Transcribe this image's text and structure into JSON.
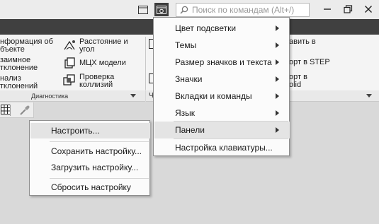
{
  "search": {
    "placeholder": "Поиск по командам (Alt+/)"
  },
  "ribbon": {
    "group1": {
      "col1": [
        "нформация об",
        "бъекте",
        "заимное",
        "тклонение",
        "нализ",
        "тклонений"
      ],
      "col2": [
        {
          "lines": [
            "Расстояние и",
            "угол"
          ],
          "icon": "distance-angle-icon"
        },
        {
          "lines": [
            "МЦХ модели"
          ],
          "icon": "mass-properties-icon"
        },
        {
          "lines": [
            "Проверка",
            "коллизий"
          ],
          "icon": "collision-check-icon"
        }
      ],
      "footer": "Диагностика"
    },
    "group3": {
      "col": [
        "авить в",
        "орт в STEP",
        "орт в",
        "olid"
      ]
    },
    "partial_letter": "Ч"
  },
  "dropdown": {
    "items": [
      {
        "label": "Цвет подсветки",
        "submenu": true
      },
      {
        "label": "Темы",
        "submenu": true
      },
      {
        "label": "Размер значков и текста",
        "submenu": true
      },
      {
        "label": "Значки",
        "submenu": true
      },
      {
        "label": "Вкладки и команды",
        "submenu": true
      },
      {
        "label": "Язык",
        "submenu": true
      },
      {
        "label": "Панели",
        "submenu": true,
        "highlighted": true
      },
      {
        "label": "Настройка клавиатуры...",
        "submenu": false
      }
    ]
  },
  "context_menu": {
    "items": [
      {
        "label": "Настроить...",
        "highlighted": true
      },
      {
        "label": "Сохранить настройку..."
      },
      {
        "label": "Загрузить настройку..."
      },
      {
        "label": "Сбросить настройку"
      }
    ]
  },
  "colors": {
    "dark_strip": "#404040",
    "highlight": "#e4e4e4",
    "menu_bg": "#fbfbfb"
  }
}
